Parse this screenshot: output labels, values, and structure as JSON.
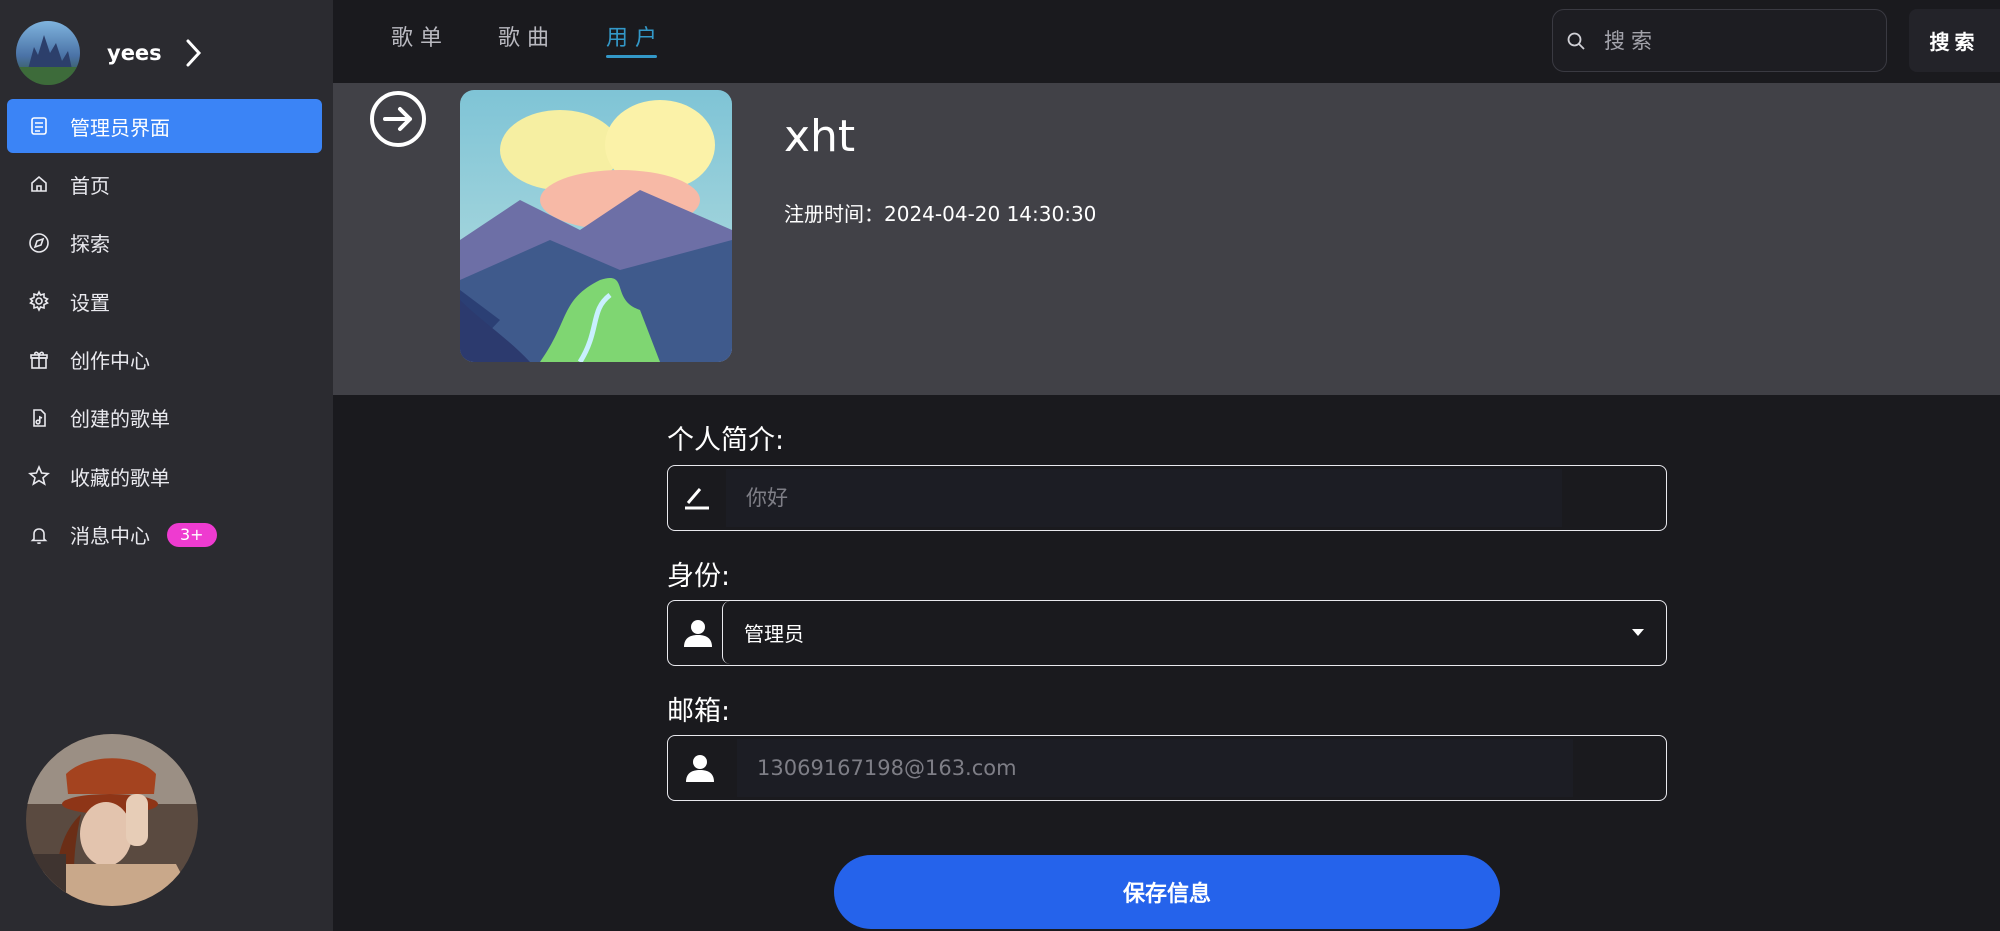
{
  "sidebar": {
    "user": {
      "name": "yees"
    },
    "menu": [
      {
        "label": "管理员界面",
        "icon": "admin-icon"
      },
      {
        "label": "首页",
        "icon": "home-icon"
      },
      {
        "label": "探索",
        "icon": "compass-icon"
      },
      {
        "label": "设置",
        "icon": "gear-icon"
      },
      {
        "label": "创作中心",
        "icon": "gift-icon"
      },
      {
        "label": "创建的歌单",
        "icon": "music-file-icon"
      },
      {
        "label": "收藏的歌单",
        "icon": "star-icon"
      },
      {
        "label": "消息中心",
        "icon": "bell-icon",
        "badge": "3+"
      }
    ]
  },
  "topbar": {
    "tabs": [
      "歌单",
      "歌曲",
      "用户"
    ],
    "active_tab": "用户",
    "search_placeholder": "搜索",
    "search_button": "搜索"
  },
  "profile": {
    "name": "xht",
    "registered": "注册时间：2024-04-20 14:30:30"
  },
  "form": {
    "bio_label": "个人简介:",
    "bio_placeholder": "你好",
    "role_label": "身份:",
    "role_value": "管理员",
    "email_label": "邮箱:",
    "email_placeholder": "13069167198@163.com",
    "save_label": "保存信息"
  },
  "colors": {
    "accent": "#3b84f6",
    "tab_active": "#3398c8",
    "badge": "#ee3bd0",
    "save_button": "#2563eb"
  }
}
